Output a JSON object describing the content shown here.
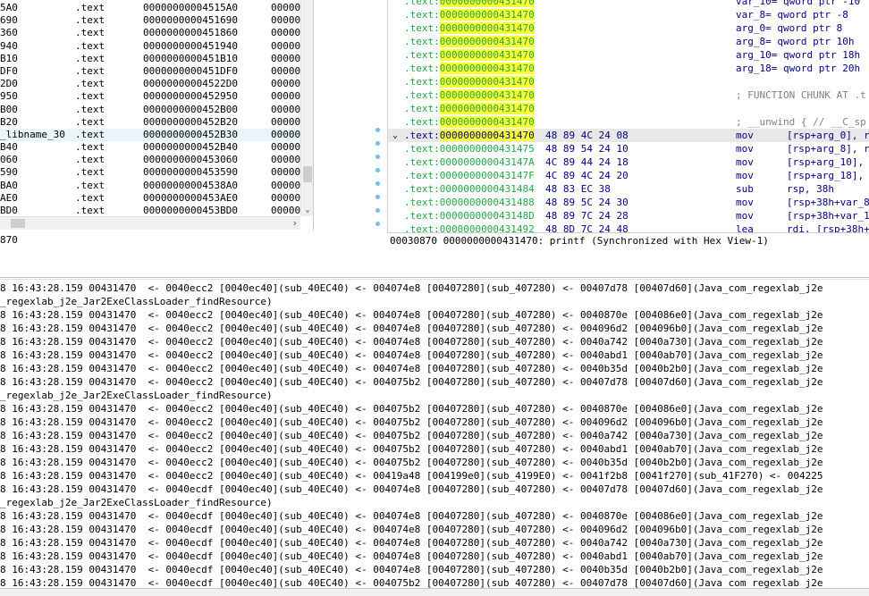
{
  "functions": {
    "rows": [
      {
        "name": "5A0",
        "segment": ".text",
        "start": "00000000004515A0",
        "length": "00000"
      },
      {
        "name": "690",
        "segment": ".text",
        "start": "0000000000451690",
        "length": "00000"
      },
      {
        "name": "360",
        "segment": ".text",
        "start": "0000000000451860",
        "length": "00000"
      },
      {
        "name": "940",
        "segment": ".text",
        "start": "0000000000451940",
        "length": "00000"
      },
      {
        "name": "B10",
        "segment": ".text",
        "start": "0000000000451B10",
        "length": "00000"
      },
      {
        "name": "DF0",
        "segment": ".text",
        "start": "0000000000451DF0",
        "length": "00000"
      },
      {
        "name": "2D0",
        "segment": ".text",
        "start": "00000000004522D0",
        "length": "00000"
      },
      {
        "name": "950",
        "segment": ".text",
        "start": "0000000000452950",
        "length": "00000"
      },
      {
        "name": "B00",
        "segment": ".text",
        "start": "0000000000452B00",
        "length": "00000"
      },
      {
        "name": "B20",
        "segment": ".text",
        "start": "0000000000452B20",
        "length": "00000"
      },
      {
        "name": "_libname_30",
        "segment": ".text",
        "start": "0000000000452B30",
        "length": "00000",
        "highlight": true
      },
      {
        "name": "B40",
        "segment": ".text",
        "start": "0000000000452B40",
        "length": "00000"
      },
      {
        "name": "060",
        "segment": ".text",
        "start": "0000000000453060",
        "length": "00000"
      },
      {
        "name": "590",
        "segment": ".text",
        "start": "0000000000453590",
        "length": "00000"
      },
      {
        "name": "BA0",
        "segment": ".text",
        "start": "00000000004538A0",
        "length": "00000"
      },
      {
        "name": "AE0",
        "segment": ".text",
        "start": "0000000000453AE0",
        "length": "00000"
      },
      {
        "name": "BD0",
        "segment": ".text",
        "start": "0000000000453BD0",
        "length": "00000"
      }
    ],
    "status": "870"
  },
  "disasm": {
    "header_lines": [
      {
        "seg": ".text:",
        "addr": "0000000000431470",
        "side": "var_10= qword ptr -10"
      },
      {
        "seg": ".text:",
        "addr": "0000000000431470",
        "side": "var_8= qword ptr -8"
      },
      {
        "seg": ".text:",
        "addr": "0000000000431470",
        "side": "arg_0= qword ptr  8"
      },
      {
        "seg": ".text:",
        "addr": "0000000000431470",
        "side": "arg_8= qword ptr  10h"
      },
      {
        "seg": ".text:",
        "addr": "0000000000431470",
        "side": "arg_10= qword ptr  18h"
      },
      {
        "seg": ".text:",
        "addr": "0000000000431470",
        "side": "arg_18= qword ptr  20h"
      },
      {
        "seg": ".text:",
        "addr": "0000000000431470",
        "side": ""
      },
      {
        "seg": ".text:",
        "addr": "0000000000431470",
        "side": "; FUNCTION CHUNK AT .t"
      },
      {
        "seg": ".text:",
        "addr": "0000000000431470",
        "side": ""
      },
      {
        "seg": ".text:",
        "addr": "0000000000431470",
        "side": "; __unwind { // __C_sp"
      }
    ],
    "code_lines": [
      {
        "seg": ".text:",
        "addr": "0000000000431470",
        "bytes": "48 89 4C 24 08",
        "mn": "mov",
        "op": "[rsp+arg_0], r",
        "current": true
      },
      {
        "seg": ".text:",
        "addr": "0000000000431475",
        "bytes": "48 89 54 24 10",
        "mn": "mov",
        "op": "[rsp+arg_8], r"
      },
      {
        "seg": ".text:",
        "addr": "000000000043147A",
        "bytes": "4C 89 44 24 18",
        "mn": "mov",
        "op": "[rsp+arg_10],"
      },
      {
        "seg": ".text:",
        "addr": "000000000043147F",
        "bytes": "4C 89 4C 24 20",
        "mn": "mov",
        "op": "[rsp+arg_18],"
      },
      {
        "seg": ".text:",
        "addr": "0000000000431484",
        "bytes": "48 83 EC 38",
        "mn": "sub",
        "op": "rsp, 38h"
      },
      {
        "seg": ".text:",
        "addr": "0000000000431488",
        "bytes": "48 89 5C 24 30",
        "mn": "mov",
        "op": "[rsp+38h+var_8"
      },
      {
        "seg": ".text:",
        "addr": "000000000043148D",
        "bytes": "48 89 7C 24 28",
        "mn": "mov",
        "op": "[rsp+38h+var_1"
      },
      {
        "seg": ".text:",
        "addr": "0000000000431492",
        "bytes": "48 8D 7C 24 48",
        "mn": "lea",
        "op": "rdi, [rsp+38h+"
      }
    ],
    "status": "00030870 0000000000431470: printf (Synchronized with Hex View-1)"
  },
  "output": {
    "lines": [
      "8 16:43:28.159 00431470  <- 0040ecc2 [0040ec40](sub_40EC40) <- 004074e8 [00407280](sub_407280) <- 00407d78 [00407d60](Java_com_regexlab_j2e",
      "_regexlab_j2e_Jar2ExeClassLoader_findResource)",
      "8 16:43:28.159 00431470  <- 0040ecc2 [0040ec40](sub_40EC40) <- 004074e8 [00407280](sub_407280) <- 0040870e [004086e0](Java_com_regexlab_j2e",
      "8 16:43:28.159 00431470  <- 0040ecc2 [0040ec40](sub_40EC40) <- 004074e8 [00407280](sub_407280) <- 004096d2 [004096b0](Java_com_regexlab_j2e",
      "8 16:43:28.159 00431470  <- 0040ecc2 [0040ec40](sub_40EC40) <- 004074e8 [00407280](sub_407280) <- 0040a742 [0040a730](Java_com_regexlab_j2e",
      "8 16:43:28.159 00431470  <- 0040ecc2 [0040ec40](sub_40EC40) <- 004074e8 [00407280](sub_407280) <- 0040abd1 [0040ab70](Java_com_regexlab_j2e",
      "8 16:43:28.159 00431470  <- 0040ecc2 [0040ec40](sub_40EC40) <- 004074e8 [00407280](sub_407280) <- 0040b35d [0040b2b0](Java_com_regexlab_j2e",
      "8 16:43:28.159 00431470  <- 0040ecc2 [0040ec40](sub_40EC40) <- 004075b2 [00407280](sub_407280) <- 00407d78 [00407d60](Java_com_regexlab_j2e",
      "_regexlab_j2e_Jar2ExeClassLoader_findResource)",
      "8 16:43:28.159 00431470  <- 0040ecc2 [0040ec40](sub_40EC40) <- 004075b2 [00407280](sub_407280) <- 0040870e [004086e0](Java_com_regexlab_j2e",
      "8 16:43:28.159 00431470  <- 0040ecc2 [0040ec40](sub_40EC40) <- 004075b2 [00407280](sub_407280) <- 004096d2 [004096b0](Java_com_regexlab_j2e",
      "8 16:43:28.159 00431470  <- 0040ecc2 [0040ec40](sub_40EC40) <- 004075b2 [00407280](sub_407280) <- 0040a742 [0040a730](Java_com_regexlab_j2e",
      "8 16:43:28.159 00431470  <- 0040ecc2 [0040ec40](sub_40EC40) <- 004075b2 [00407280](sub_407280) <- 0040abd1 [0040ab70](Java_com_regexlab_j2e",
      "8 16:43:28.159 00431470  <- 0040ecc2 [0040ec40](sub_40EC40) <- 004075b2 [00407280](sub_407280) <- 0040b35d [0040b2b0](Java_com_regexlab_j2e",
      "8 16:43:28.159 00431470  <- 0040ecc2 [0040ec40](sub_40EC40) <- 00419a48 [004199e0](sub_4199E0) <- 0041f2b8 [0041f270](sub_41F270) <- 004225",
      "8 16:43:28.159 00431470  <- 0040ecdf [0040ec40](sub_40EC40) <- 004074e8 [00407280](sub_407280) <- 00407d78 [00407d60](Java_com_regexlab_j2e",
      "_regexlab_j2e_Jar2ExeClassLoader_findResource)",
      "8 16:43:28.159 00431470  <- 0040ecdf [0040ec40](sub_40EC40) <- 004074e8 [00407280](sub_407280) <- 0040870e [004086e0](Java_com_regexlab_j2e",
      "8 16:43:28.159 00431470  <- 0040ecdf [0040ec40](sub_40EC40) <- 004074e8 [00407280](sub_407280) <- 004096d2 [004096b0](Java_com_regexlab_j2e",
      "8 16:43:28.159 00431470  <- 0040ecdf [0040ec40](sub_40EC40) <- 004074e8 [00407280](sub_407280) <- 0040a742 [0040a730](Java_com_regexlab_j2e",
      "8 16:43:28.159 00431470  <- 0040ecdf [0040ec40](sub_40EC40) <- 004074e8 [00407280](sub_407280) <- 0040abd1 [0040ab70](Java_com_regexlab_j2e",
      "8 16:43:28.159 00431470  <- 0040ecdf [0040ec40](sub_40EC40) <- 004074e8 [00407280](sub_407280) <- 0040b35d [0040b2b0](Java_com_regexlab_j2e",
      "8 16:43:28.159 00431470  <- 0040ecdf [0040ec40](sub_40EC40) <- 004075b2 [00407280](sub_407280) <- 00407d78 [00407d60](Java_com_regexlab_j2e"
    ]
  },
  "colors": {
    "address_green": "#27a34a",
    "code_blue": "#000080",
    "address_highlight": "#ffff33",
    "current_line": "#e8e8e8",
    "flow_dot": "#6fbfe8"
  },
  "icons": {
    "collapse": "chevron-down-icon",
    "scroll_down": "arrow-down-icon",
    "scroll_right": "arrow-right-icon"
  }
}
